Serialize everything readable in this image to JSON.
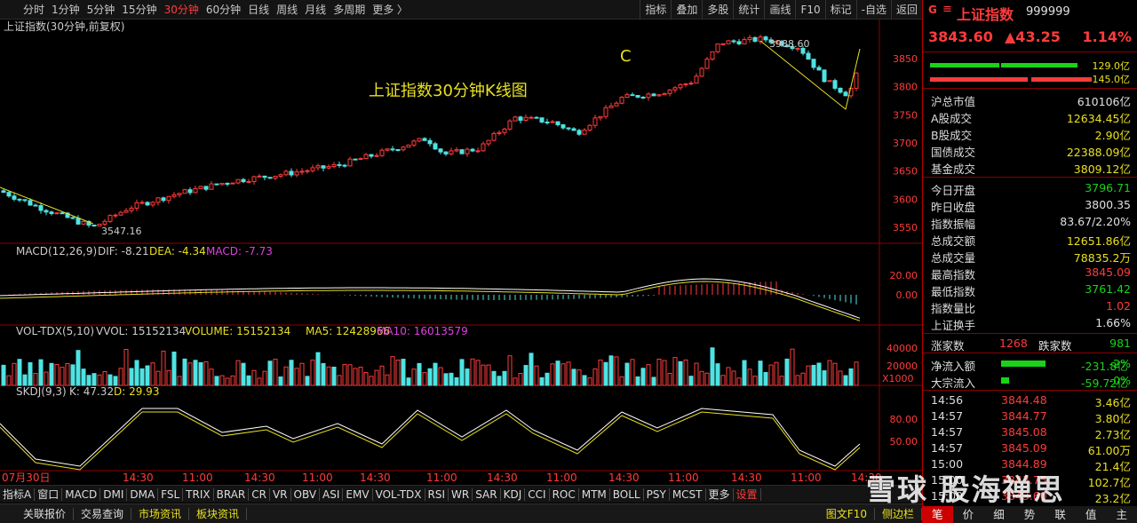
{
  "topbar": {
    "periods": [
      "分时",
      "1分钟",
      "5分钟",
      "15分钟",
      "30分钟",
      "60分钟",
      "日线",
      "周线",
      "月线",
      "多周期",
      "更多 〉"
    ],
    "active_index": 4,
    "tools": [
      "指标",
      "叠加",
      "多股",
      "统计",
      "画线",
      "F10",
      "标记",
      "-自选",
      "返回"
    ]
  },
  "chart": {
    "title": "上证指数(30分钟,前复权)",
    "annotation": "上证指数30分钟K线图",
    "wave_label": "C",
    "high_label": "3988.60",
    "low_label": "3547.16",
    "price_axis": [
      "3850",
      "3800",
      "3750",
      "3700",
      "3650",
      "3600",
      "3550"
    ],
    "macd": {
      "name": "MACD(12,26,9)",
      "dif_label": "DIF: -8.21",
      "dea_label": "DEA: -4.34",
      "macd_label": "MACD: -7.73",
      "axis": [
        "20.00",
        "0.00"
      ]
    },
    "vol": {
      "name": "VOL-TDX(5,10)",
      "vvol_label": "VVOL: 15152134",
      "volume_label": "VOLUME: 15152134",
      "ma5_label": "MA5: 12428966",
      "ma10_label": "MA10: 16013579",
      "axis": [
        "40000",
        "20000"
      ],
      "unit": "X1000"
    },
    "skdj": {
      "name": "SKDJ(9,3)",
      "k_label": "K: 47.32",
      "d_label": "D: 29.93",
      "axis": [
        "80.00",
        "50.00"
      ]
    },
    "time_axis": [
      "07月30日",
      "14:30",
      "11:00",
      "14:30",
      "11:00",
      "14:30",
      "11:00",
      "14:30",
      "11:00",
      "14:30",
      "11:00",
      "14:30",
      "11:00",
      "14:30",
      "11:00",
      "14:30"
    ]
  },
  "watermark": "雪球  股海禅思",
  "indicator_bar": [
    "指标A",
    "窗口",
    "MACD",
    "DMI",
    "DMA",
    "FSL",
    "TRIX",
    "BRAR",
    "CR",
    "VR",
    "OBV",
    "ASI",
    "EMV",
    "VOL-TDX",
    "RSI",
    "WR",
    "SAR",
    "KDJ",
    "CCI",
    "ROC",
    "MTM",
    "BOLL",
    "PSY",
    "MCST",
    "更多",
    "设置"
  ],
  "status_tabs": [
    "关联报价",
    "交易查询",
    "市场资讯",
    "板块资讯"
  ],
  "status_right": [
    "图文F10",
    "侧边栏"
  ],
  "panel": {
    "badge": "G",
    "menu": "≡",
    "name": "上证指数",
    "code": "999999",
    "price": "3843.60",
    "change": "▲43.25",
    "pct": "1.14%",
    "buy_ratio": "129.0亿",
    "sell_ratio": "145.0亿",
    "stats": [
      {
        "k": "沪总市值",
        "v": "610106亿",
        "c": "wht"
      },
      {
        "k": "A股成交",
        "v": "12634.45亿",
        "c": "yel"
      },
      {
        "k": "B股成交",
        "v": "2.90亿",
        "c": "yel"
      },
      {
        "k": "国债成交",
        "v": "22388.09亿",
        "c": "yel"
      },
      {
        "k": "基金成交",
        "v": "3809.12亿",
        "c": "yel"
      }
    ],
    "stats2": [
      {
        "k": "今日开盘",
        "v": "3796.71",
        "c": "green"
      },
      {
        "k": "昨日收盘",
        "v": "3800.35",
        "c": "wht"
      },
      {
        "k": "指数振幅",
        "v": "83.67/2.20%",
        "c": "wht"
      },
      {
        "k": "总成交额",
        "v": "12651.86亿",
        "c": "yel"
      },
      {
        "k": "总成交量",
        "v": "78835.2万",
        "c": "yel"
      },
      {
        "k": "最高指数",
        "v": "3845.09",
        "c": "red"
      },
      {
        "k": "最低指数",
        "v": "3761.42",
        "c": "green"
      },
      {
        "k": "指数量比",
        "v": "1.02",
        "c": "red"
      },
      {
        "k": "上证换手",
        "v": "1.66%",
        "c": "wht"
      }
    ],
    "up_label": "涨家数",
    "up": "1268",
    "down_label": "跌家数",
    "down": "981",
    "flow": [
      {
        "k": "净流入额",
        "v": "-231.8亿",
        "p": "-2%",
        "bar": 0.55
      },
      {
        "k": "大宗流入",
        "v": "-59.72亿",
        "p": "-0%",
        "bar": 0.1
      }
    ],
    "ticks": [
      {
        "t": "14:56",
        "p": "3844.48",
        "v": "3.46亿"
      },
      {
        "t": "14:57",
        "p": "3844.77",
        "v": "3.80亿"
      },
      {
        "t": "14:57",
        "p": "3845.08",
        "v": "2.73亿"
      },
      {
        "t": "14:57",
        "p": "3845.09",
        "v": "61.00万"
      },
      {
        "t": "15:00",
        "p": "3844.89",
        "v": "21.4亿"
      },
      {
        "t": "15:00",
        "p": "3843.75",
        "v": "102.7亿"
      },
      {
        "t": "15:00",
        "p": "3843.60",
        "v": "23.2亿"
      }
    ],
    "bottom_tabs": [
      "笔",
      "价",
      "细",
      "势",
      "联",
      "值",
      "主"
    ],
    "bottom_active": 0
  }
}
